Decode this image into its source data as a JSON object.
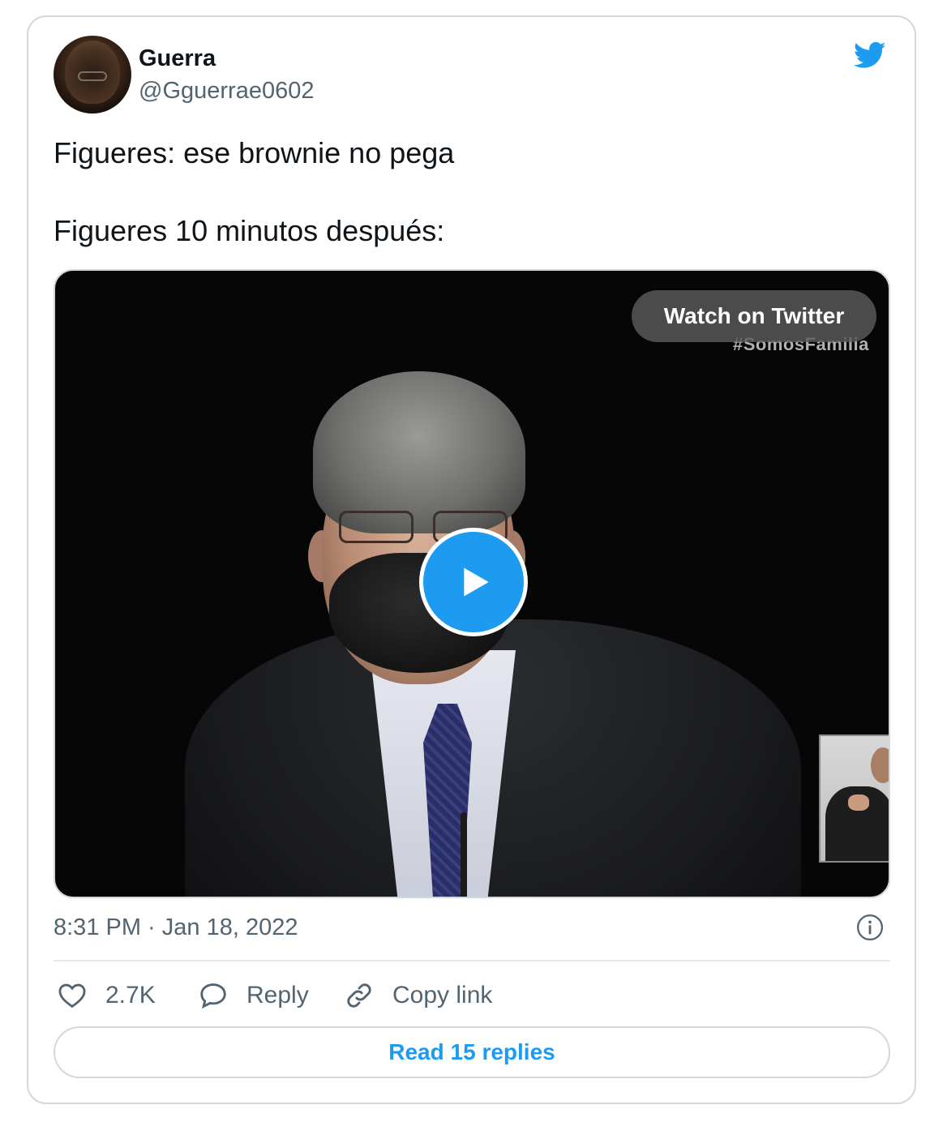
{
  "tweet": {
    "author_name": "Guerra",
    "author_handle": "@Gguerrae0602",
    "text_line1": "Figueres: ese brownie no pega",
    "text_line2": "Figueres 10 minutos después:",
    "timestamp": "8:31 PM · Jan 18, 2022"
  },
  "media": {
    "watch_label": "Watch on Twitter",
    "overlay_text": "#SomosFamilia",
    "play_icon": "play-icon"
  },
  "actions": {
    "like_count": "2.7K",
    "reply_label": "Reply",
    "copy_label": "Copy link"
  },
  "footer": {
    "read_replies_label": "Read 15 replies"
  },
  "icons": {
    "brand": "twitter-bird-icon",
    "info": "info-icon",
    "like": "heart-icon",
    "reply": "reply-bubble-icon",
    "copy": "link-icon"
  },
  "colors": {
    "accent": "#1d9bf0",
    "text": "#0f1419",
    "secondary": "#536471",
    "border": "#cfd9de"
  }
}
